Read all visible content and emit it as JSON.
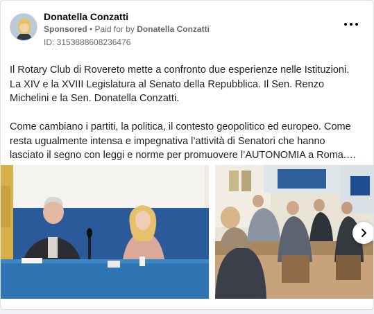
{
  "ad": {
    "advertiser_name": "Donatella Conzatti",
    "sponsored_label": "Sponsored",
    "separator": " • ",
    "paid_for_prefix": "Paid for by ",
    "paid_for_name": "Donatella Conzatti",
    "id_text": "ID: 3153888608236476",
    "body_paragraph_1": "Il Rotary Club di Rovereto mette a confronto due esperienze nelle Istituzioni. La XIV e la XVIII Legislatura al Senato della Repubblica. Il Sen. Renzo Michelini e la Sen. Donatella Conzatti.",
    "body_paragraph_2": "Come cambiano i partiti, la politica, il contesto geopolitico ed europeo. Come resta ugualmente intensa e impegnativa l’attività di Senatori che hanno lasciato il segno con leggi e norme per promuovere l’AUTONOMIA a Roma.…"
  },
  "icons": {
    "more": "more-options-icon",
    "next": "chevron-right-icon",
    "avatar": "profile-photo"
  },
  "colors": {
    "text_primary": "#050505",
    "text_secondary": "#65676b",
    "card_border": "#dddfe2",
    "page_background": "#f0f2f5"
  }
}
